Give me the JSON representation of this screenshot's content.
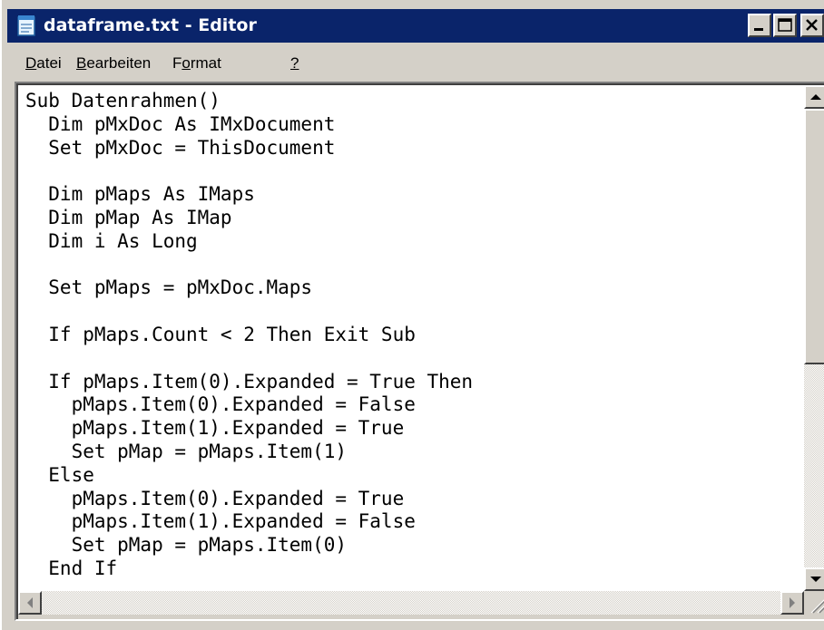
{
  "window": {
    "title": "dataframe.txt - Editor",
    "buttons": {
      "minimize": "minimize-icon",
      "maximize": "maximize-icon",
      "close": "close-icon"
    }
  },
  "menu": [
    {
      "pre": "",
      "key": "D",
      "post": "atei"
    },
    {
      "pre": "",
      "key": "B",
      "post": "earbeiten"
    },
    {
      "pre": "F",
      "key": "o",
      "post": "rmat"
    },
    {
      "pre": "",
      "key": "?",
      "post": ""
    }
  ],
  "editor": {
    "lines": [
      "Sub Datenrahmen()",
      "  Dim pMxDoc As IMxDocument",
      "  Set pMxDoc = ThisDocument",
      "",
      "  Dim pMaps As IMaps",
      "  Dim pMap As IMap",
      "  Dim i As Long",
      "",
      "  Set pMaps = pMxDoc.Maps",
      "",
      "  If pMaps.Count < 2 Then Exit Sub",
      "",
      "  If pMaps.Item(0).Expanded = True Then",
      "    pMaps.Item(0).Expanded = False",
      "    pMaps.Item(1).Expanded = True",
      "    Set pMap = pMaps.Item(1)",
      "  Else",
      "    pMaps.Item(0).Expanded = True",
      "    pMaps.Item(1).Expanded = False",
      "    Set pMap = pMaps.Item(0)",
      "  End If"
    ]
  },
  "colors": {
    "titlebar": "#0a246a",
    "face": "#d4d0c8"
  }
}
